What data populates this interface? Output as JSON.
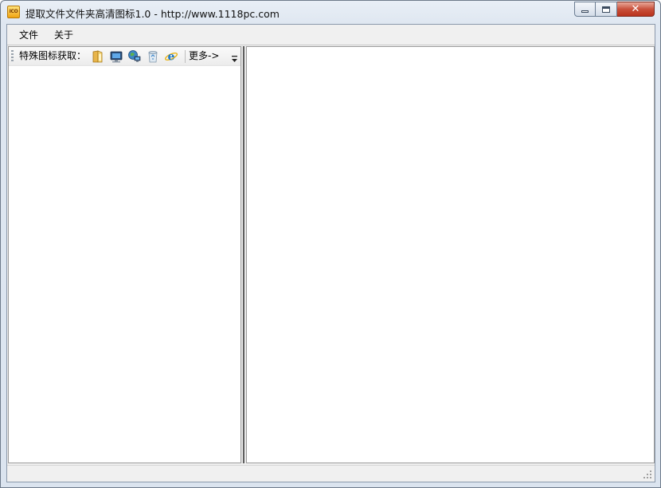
{
  "window": {
    "title": "提取文件文件夹高清图标1.0 - http://www.1118pc.com",
    "app_icon_text": "ICO",
    "controls": {
      "minimize": "minimize-icon",
      "maximize": "maximize-icon",
      "close": "close-icon"
    }
  },
  "menubar": {
    "items": [
      {
        "label": "文件"
      },
      {
        "label": "关于"
      }
    ]
  },
  "toolbar": {
    "label": "特殊图标获取：",
    "icons": [
      "folder-icon",
      "my-computer-icon",
      "network-icon",
      "recycle-bin-icon",
      "internet-explorer-icon"
    ],
    "more_label": "更多->"
  },
  "colors": {
    "title_gradient_top": "#e9eff6",
    "close_button": "#c9503b",
    "pane_background": "#ffffff",
    "chrome_background": "#f0f0f0"
  }
}
